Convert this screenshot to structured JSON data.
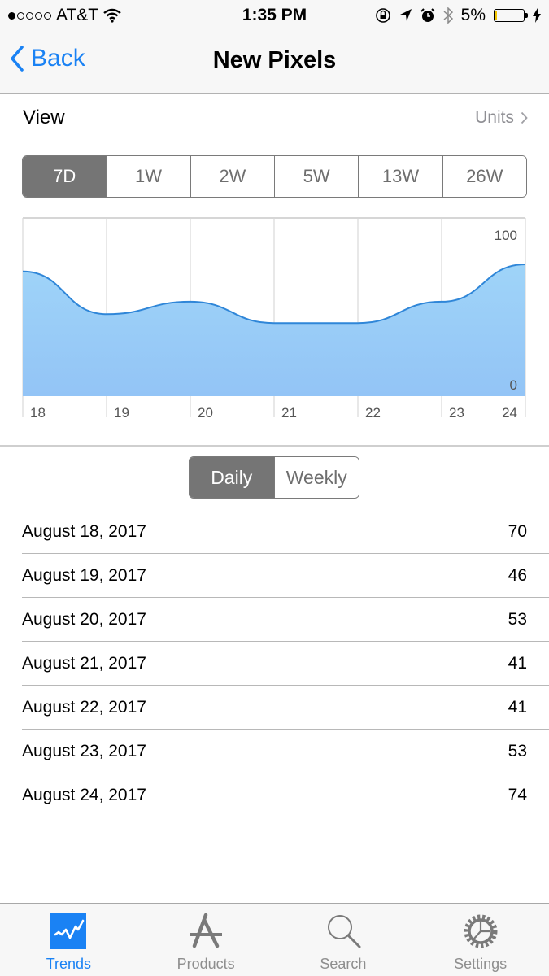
{
  "status_bar": {
    "signal_dots_filled": 1,
    "signal_dots_total": 5,
    "carrier": "AT&T",
    "time": "1:35 PM",
    "battery": "5%",
    "battery_level": 0.05,
    "icons": [
      "wifi-icon",
      "rotation-lock-icon",
      "location-icon",
      "alarm-icon",
      "bluetooth-icon",
      "charging-icon"
    ]
  },
  "nav": {
    "back_label": "Back",
    "title": "New Pixels"
  },
  "view_row": {
    "label": "View",
    "value": "Units"
  },
  "range_tabs": [
    {
      "label": "7D",
      "active": true
    },
    {
      "label": "1W",
      "active": false
    },
    {
      "label": "2W",
      "active": false
    },
    {
      "label": "5W",
      "active": false
    },
    {
      "label": "13W",
      "active": false
    },
    {
      "label": "26W",
      "active": false
    }
  ],
  "period_tabs": [
    {
      "label": "Daily",
      "active": true
    },
    {
      "label": "Weekly",
      "active": false
    }
  ],
  "colors": {
    "accent": "#1a82f4",
    "line": "#2f86d8",
    "fill_top": "#9fd4f8",
    "fill_bottom": "#93c4f6",
    "segment_active": "#757575"
  },
  "chart_data": {
    "type": "area",
    "x": [
      "18",
      "19",
      "20",
      "21",
      "22",
      "23",
      "24"
    ],
    "values": [
      70,
      46,
      53,
      41,
      41,
      53,
      74
    ],
    "ylim": [
      0,
      100
    ],
    "ytick_labels": [
      "100",
      "0"
    ],
    "grid": true,
    "title": "",
    "xlabel": "",
    "ylabel": ""
  },
  "table": {
    "rows": [
      {
        "date": "August 18, 2017",
        "value": "70"
      },
      {
        "date": "August 19, 2017",
        "value": "46"
      },
      {
        "date": "August 20, 2017",
        "value": "53"
      },
      {
        "date": "August 21, 2017",
        "value": "41"
      },
      {
        "date": "August 22, 2017",
        "value": "41"
      },
      {
        "date": "August 23, 2017",
        "value": "53"
      },
      {
        "date": "August 24, 2017",
        "value": "74"
      }
    ]
  },
  "tab_bar": [
    {
      "label": "Trends",
      "icon": "trends-icon",
      "active": true
    },
    {
      "label": "Products",
      "icon": "products-icon",
      "active": false
    },
    {
      "label": "Search",
      "icon": "search-icon",
      "active": false
    },
    {
      "label": "Settings",
      "icon": "settings-icon",
      "active": false
    }
  ]
}
